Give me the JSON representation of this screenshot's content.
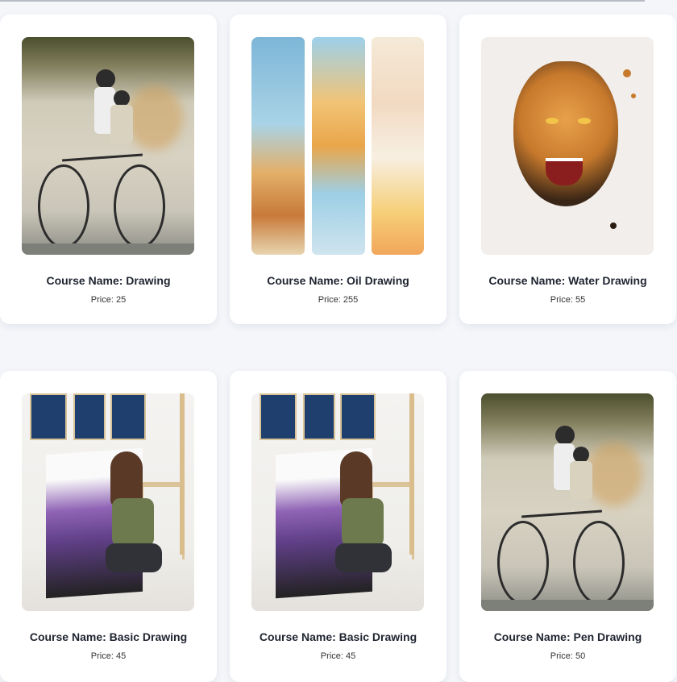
{
  "courses": [
    {
      "name": "Course Name: Drawing",
      "price": "Price: 25",
      "image": "bicycle-mural"
    },
    {
      "name": "Course Name: Oil Drawing",
      "price": "Price: 255",
      "image": "oil-painting-triptych"
    },
    {
      "name": "Course Name: Water Drawing",
      "price": "Price: 55",
      "image": "tiger-illustration"
    },
    {
      "name": "Course Name: Basic Drawing",
      "price": "Price: 45",
      "image": "woman-painting-canvas"
    },
    {
      "name": "Course Name: Basic Drawing",
      "price": "Price: 45",
      "image": "woman-painting-canvas"
    },
    {
      "name": "Course Name: Pen Drawing",
      "price": "Price: 50",
      "image": "bicycle-mural"
    }
  ]
}
